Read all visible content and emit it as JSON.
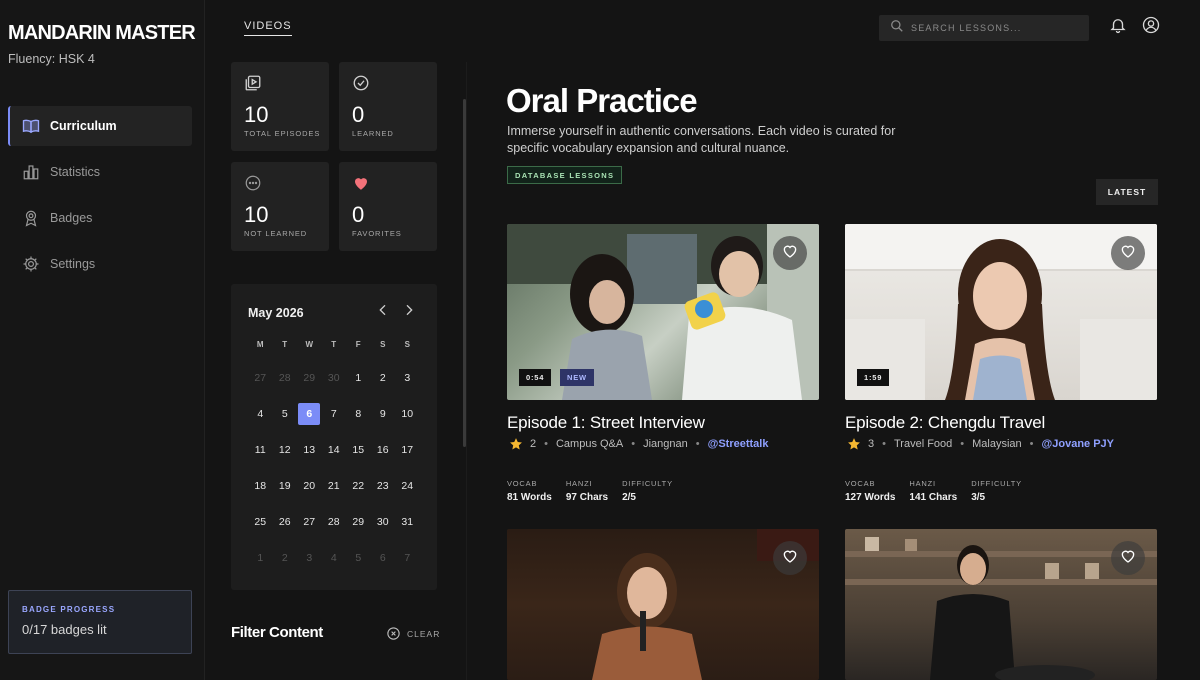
{
  "sidebar": {
    "brand": "MANDARIN MASTER",
    "fluency": "Fluency: HSK 4",
    "items": [
      {
        "label": "Curriculum",
        "icon": "book-icon"
      },
      {
        "label": "Statistics",
        "icon": "bar-chart-icon"
      },
      {
        "label": "Badges",
        "icon": "badge-icon"
      },
      {
        "label": "Settings",
        "icon": "gear-icon"
      }
    ],
    "badge_progress": {
      "title": "BADGE PROGRESS",
      "value": "0/17 badges lit"
    }
  },
  "topbar": {
    "tab": "VIDEOS",
    "search_placeholder": "SEARCH LESSONS...",
    "icons": [
      "bell-icon",
      "user-circle-icon"
    ]
  },
  "stats": [
    {
      "value": "10",
      "label": "TOTAL EPISODES",
      "icon": "play-square-icon"
    },
    {
      "value": "0",
      "label": "LEARNED",
      "icon": "check-circle-icon"
    },
    {
      "value": "10",
      "label": "NOT LEARNED",
      "icon": "ellipsis-circle-icon"
    },
    {
      "value": "0",
      "label": "FAVORITES",
      "icon": "heart-icon"
    }
  ],
  "calendar": {
    "title": "May 2026",
    "weekdays": [
      "M",
      "T",
      "W",
      "T",
      "F",
      "S",
      "S"
    ],
    "days": [
      "27",
      "28",
      "29",
      "30",
      "1",
      "2",
      "3",
      "4",
      "5",
      "6",
      "7",
      "8",
      "9",
      "10",
      "11",
      "12",
      "13",
      "14",
      "15",
      "16",
      "17",
      "18",
      "19",
      "20",
      "21",
      "22",
      "23",
      "24",
      "25",
      "26",
      "27",
      "28",
      "29",
      "30",
      "31",
      "1",
      "2",
      "3",
      "4",
      "5",
      "6",
      "7"
    ],
    "selected": "6"
  },
  "filter": {
    "title": "Filter Content",
    "clear_label": "CLEAR"
  },
  "main": {
    "title": "Oral Practice",
    "description": "Immerse yourself in authentic conversations. Each video is curated for specific vocabulary expansion and cultural nuance.",
    "badge": "DATABASE LESSONS",
    "sort_label": "LATEST"
  },
  "episodes": [
    {
      "title": "Episode 1: Street Interview",
      "duration": "0:54",
      "tag": "NEW",
      "rating": "2",
      "category": "Campus Q&A",
      "dialect": "Jiangnan",
      "handle": "@Streettalk",
      "stats": [
        {
          "label": "VOCAB",
          "value": "81 Words"
        },
        {
          "label": "HANZI",
          "value": "97 Chars"
        },
        {
          "label": "DIFFICULTY",
          "value": "2/5"
        }
      ]
    },
    {
      "title": "Episode 2: Chengdu Travel",
      "duration": "1:59",
      "rating": "3",
      "category": "Travel Food",
      "dialect": "Malaysian",
      "handle": "@Jovane PJY",
      "stats": [
        {
          "label": "VOCAB",
          "value": "127 Words"
        },
        {
          "label": "HANZI",
          "value": "141 Chars"
        },
        {
          "label": "DIFFICULTY",
          "value": "3/5"
        }
      ]
    }
  ],
  "colors": {
    "accent": "#7b8cf7",
    "background": "#141414",
    "panel": "#222222",
    "favorite": "#f4727a",
    "star": "#f5b731",
    "badge_green": "#a9e3b4"
  }
}
